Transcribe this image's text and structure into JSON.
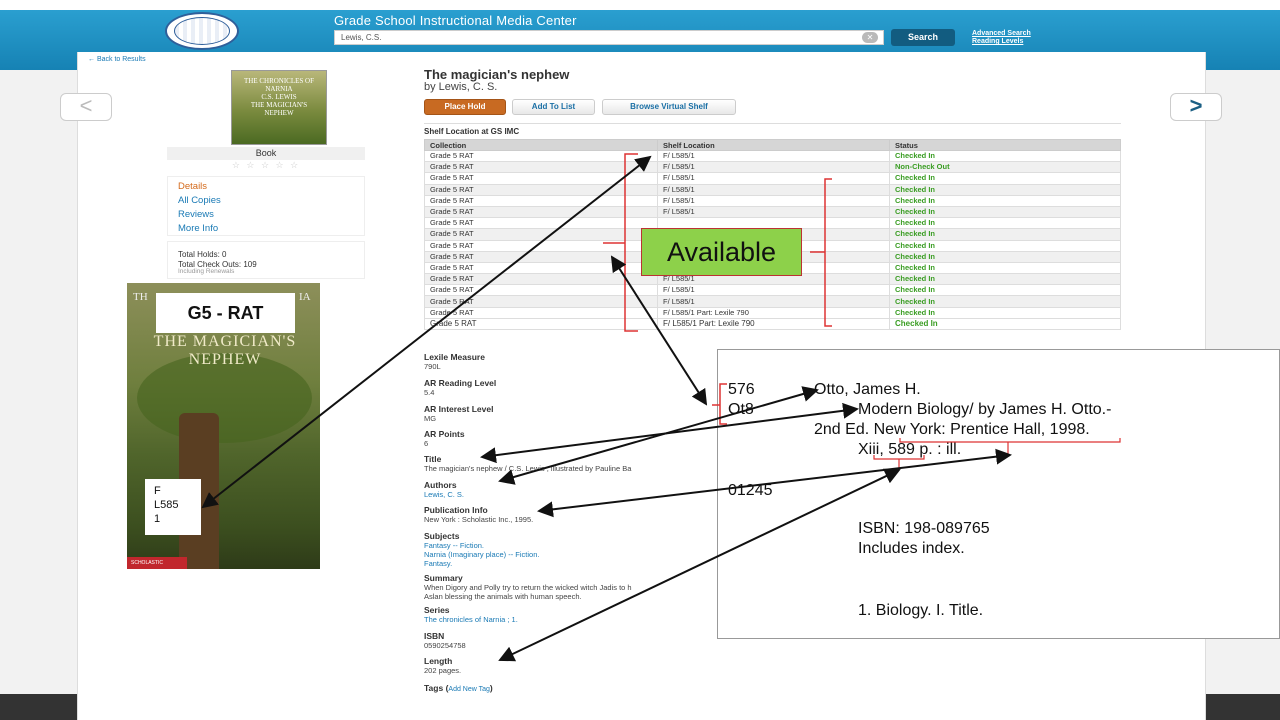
{
  "header": {
    "site_title": "Grade School Instructional Media Center",
    "search_value": "Lewis, C.S.",
    "search_button": "Search",
    "advanced_search": "Advanced Search",
    "reading_levels": "Reading Levels",
    "clear_icon": "x-circle-icon"
  },
  "nav": {
    "back_to_results": "← Back to Results",
    "prev_glyph": "<",
    "next_glyph": ">"
  },
  "book": {
    "title": "The magician's nephew",
    "by": "by Lewis, C. S.",
    "format": "Book",
    "stars": "☆ ☆ ☆ ☆ ☆",
    "cover_small_text": "THE CHRONICLES OF NARNIA\nC.S. LEWIS\nTHE MAGICIAN'S\nNEPHEW"
  },
  "actions": {
    "place_hold": "Place Hold",
    "add_to_list": "Add To List",
    "browse_shelf": "Browse Virtual Shelf"
  },
  "side_menu": {
    "details": "Details",
    "all_copies": "All Copies",
    "reviews": "Reviews",
    "more_info": "More Info"
  },
  "holds": {
    "total_holds": "Total Holds: 0",
    "total_checkouts": "Total Check Outs: 109",
    "including": "Including Renewals"
  },
  "shelf": {
    "heading": "Shelf Location at GS IMC",
    "columns": [
      "Collection",
      "Shelf Location",
      "Status"
    ],
    "rows": [
      [
        "Grade 5 RAT",
        "F/ L585/1",
        "Checked In"
      ],
      [
        "Grade 5 RAT",
        "F/ L585/1",
        "Non-Check Out"
      ],
      [
        "Grade 5 RAT",
        "F/ L585/1",
        "Checked In"
      ],
      [
        "Grade 5 RAT",
        "F/ L585/1",
        "Checked In"
      ],
      [
        "Grade 5 RAT",
        "F/ L585/1",
        "Checked In"
      ],
      [
        "Grade 5 RAT",
        "F/ L585/1",
        "Checked In"
      ],
      [
        "Grade 5 RAT",
        "",
        "Checked In"
      ],
      [
        "Grade 5 RAT",
        "",
        "Checked In"
      ],
      [
        "Grade 5 RAT",
        "",
        "Checked In"
      ],
      [
        "Grade 5 RAT",
        "",
        "Checked In"
      ],
      [
        "Grade 5 RAT",
        "F/ L585/1",
        "Checked In"
      ],
      [
        "Grade 5 RAT",
        "F/ L585/1",
        "Checked In"
      ],
      [
        "Grade 5 RAT",
        "F/ L585/1",
        "Checked In"
      ],
      [
        "Grade 5 RAT",
        "F/ L585/1",
        "Checked In"
      ],
      [
        "Grade 5 RAT",
        "F/ L585/1 Part: Lexile 790",
        "Checked In"
      ],
      [
        "Grade 5 RAT",
        "F/ L585/1 Part: Lexile 790",
        "Checked In"
      ]
    ]
  },
  "fields": {
    "lexile_label": "Lexile Measure",
    "lexile_value": "790L",
    "ar_reading_label": "AR Reading Level",
    "ar_reading_value": "5.4",
    "ar_interest_label": "AR Interest Level",
    "ar_interest_value": "MG",
    "ar_points_label": "AR Points",
    "ar_points_value": "6",
    "title_label": "Title",
    "title_value": "The magician's nephew / C.S. Lewis ; illustrated by Pauline Ba",
    "authors_label": "Authors",
    "authors_value": "Lewis, C. S.",
    "pub_label": "Publication Info",
    "pub_value": "New York : Scholastic Inc., 1995.",
    "subjects_label": "Subjects",
    "subject_1": "Fantasy -- Fiction.",
    "subject_2": "Narnia (Imaginary place) -- Fiction.",
    "subject_3": "Fantasy.",
    "summary_label": "Summary",
    "summary_1": "When Digory and Polly try to return the wicked witch Jadis to h",
    "summary_2": "Aslan blessing the animals with human speech.",
    "series_label": "Series",
    "series_value": "The chronicles of Narnia ; 1.",
    "isbn_label": "ISBN",
    "isbn_value": "0590254758",
    "length_label": "Length",
    "length_value": "202 pages.",
    "tags_label": "Tags (",
    "tags_add": "Add New Tag",
    "tags_close": ")"
  },
  "annotations": {
    "g5_label": "G5 - RAT",
    "spine_1": "F",
    "spine_2": "L585",
    "spine_3": "1",
    "available": "Available",
    "large_cover_title": "THE MAGICIAN'S NEPHEW",
    "large_cover_top_left": "TH",
    "large_cover_top_right": "IA"
  },
  "card": {
    "call_1": "576",
    "call_2": "Ot8",
    "author": "Otto, James H.",
    "title_line": "Modern Biology/ by James H. Otto.-",
    "edition_line": "2nd Ed. New York: Prentice Hall, 1998.",
    "pages_line": "Xiii, 589 p. : ill.",
    "accession": "01245",
    "isbn": "ISBN: 198-089765",
    "index": "Includes index.",
    "tracing": "1. Biology. I. Title."
  }
}
